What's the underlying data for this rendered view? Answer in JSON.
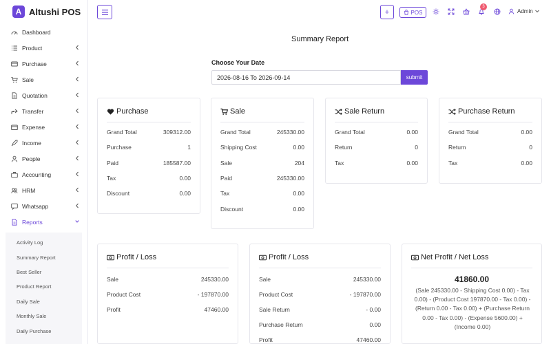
{
  "brand": {
    "logo_letter": "A",
    "name": "Altushi POS"
  },
  "sidebar": {
    "items": [
      {
        "label": "Dashboard",
        "icon": "dashboard-icon",
        "chevron": false
      },
      {
        "label": "Product",
        "icon": "list-icon",
        "chevron": true
      },
      {
        "label": "Purchase",
        "icon": "card-icon",
        "chevron": true
      },
      {
        "label": "Sale",
        "icon": "cart-icon",
        "chevron": true
      },
      {
        "label": "Quotation",
        "icon": "document-icon",
        "chevron": true
      },
      {
        "label": "Transfer",
        "icon": "share-icon",
        "chevron": true
      },
      {
        "label": "Expense",
        "icon": "wallet-icon",
        "chevron": true
      },
      {
        "label": "Income",
        "icon": "rocket-icon",
        "chevron": true
      },
      {
        "label": "People",
        "icon": "person-icon",
        "chevron": true
      },
      {
        "label": "Accounting",
        "icon": "briefcase-icon",
        "chevron": true
      },
      {
        "label": "HRM",
        "icon": "users-icon",
        "chevron": true
      },
      {
        "label": "Whatsapp",
        "icon": "chat-icon",
        "chevron": true
      },
      {
        "label": "Reports",
        "icon": "report-icon",
        "chevron": true,
        "active": true
      }
    ],
    "reports_sub": [
      "Activity Log",
      "Summary Report",
      "Best Seller",
      "Product Report",
      "Daily Sale",
      "Monthly Sale",
      "Daily Purchase"
    ]
  },
  "header": {
    "plus_label": "+",
    "pos_label": "POS",
    "notification_count": "3",
    "user_name": "Admin"
  },
  "main": {
    "title": "Summary Report",
    "date_label": "Choose Your Date",
    "date_value": "2026-08-16 To 2026-09-14",
    "submit_label": "submit"
  },
  "cards": {
    "purchase": {
      "title": "Purchase",
      "rows": [
        {
          "label": "Grand Total",
          "value": "309312.00"
        },
        {
          "label": "Purchase",
          "value": "1"
        },
        {
          "label": "Paid",
          "value": "185587.00"
        },
        {
          "label": "Tax",
          "value": "0.00"
        },
        {
          "label": "Discount",
          "value": "0.00"
        }
      ]
    },
    "sale": {
      "title": "Sale",
      "rows": [
        {
          "label": "Grand Total",
          "value": "245330.00"
        },
        {
          "label": "Shipping Cost",
          "value": "0.00"
        },
        {
          "label": "Sale",
          "value": "204"
        },
        {
          "label": "Paid",
          "value": "245330.00"
        },
        {
          "label": "Tax",
          "value": "0.00"
        },
        {
          "label": "Discount",
          "value": "0.00"
        }
      ]
    },
    "sale_return": {
      "title": "Sale Return",
      "rows": [
        {
          "label": "Grand Total",
          "value": "0.00"
        },
        {
          "label": "Return",
          "value": "0"
        },
        {
          "label": "Tax",
          "value": "0.00"
        }
      ]
    },
    "purchase_return": {
      "title": "Purchase Return",
      "rows": [
        {
          "label": "Grand Total",
          "value": "0.00"
        },
        {
          "label": "Return",
          "value": "0"
        },
        {
          "label": "Tax",
          "value": "0.00"
        }
      ]
    },
    "profit_loss_1": {
      "title": "Profit / Loss",
      "rows": [
        {
          "label": "Sale",
          "value": "245330.00"
        },
        {
          "label": "Product Cost",
          "value": "- 197870.00"
        },
        {
          "label": "Profit",
          "value": "47460.00"
        }
      ]
    },
    "profit_loss_2": {
      "title": "Profit / Loss",
      "rows": [
        {
          "label": "Sale",
          "value": "245330.00"
        },
        {
          "label": "Product Cost",
          "value": "- 197870.00"
        },
        {
          "label": "Sale Return",
          "value": "- 0.00"
        },
        {
          "label": "Purchase Return",
          "value": "0.00"
        },
        {
          "label": "Profit",
          "value": "47460.00"
        }
      ]
    },
    "net_profit": {
      "title": "Net Profit / Net Loss",
      "value": "41860.00",
      "formula": "(Sale 245330.00 - Shipping Cost 0.00) - Tax 0.00) - (Product Cost 197870.00 - Tax 0.00) - (Return 0.00 - Tax 0.00) + (Purchase Return 0.00 - Tax 0.00) - (Expense 5600.00) + (Income 0.00)"
    }
  }
}
